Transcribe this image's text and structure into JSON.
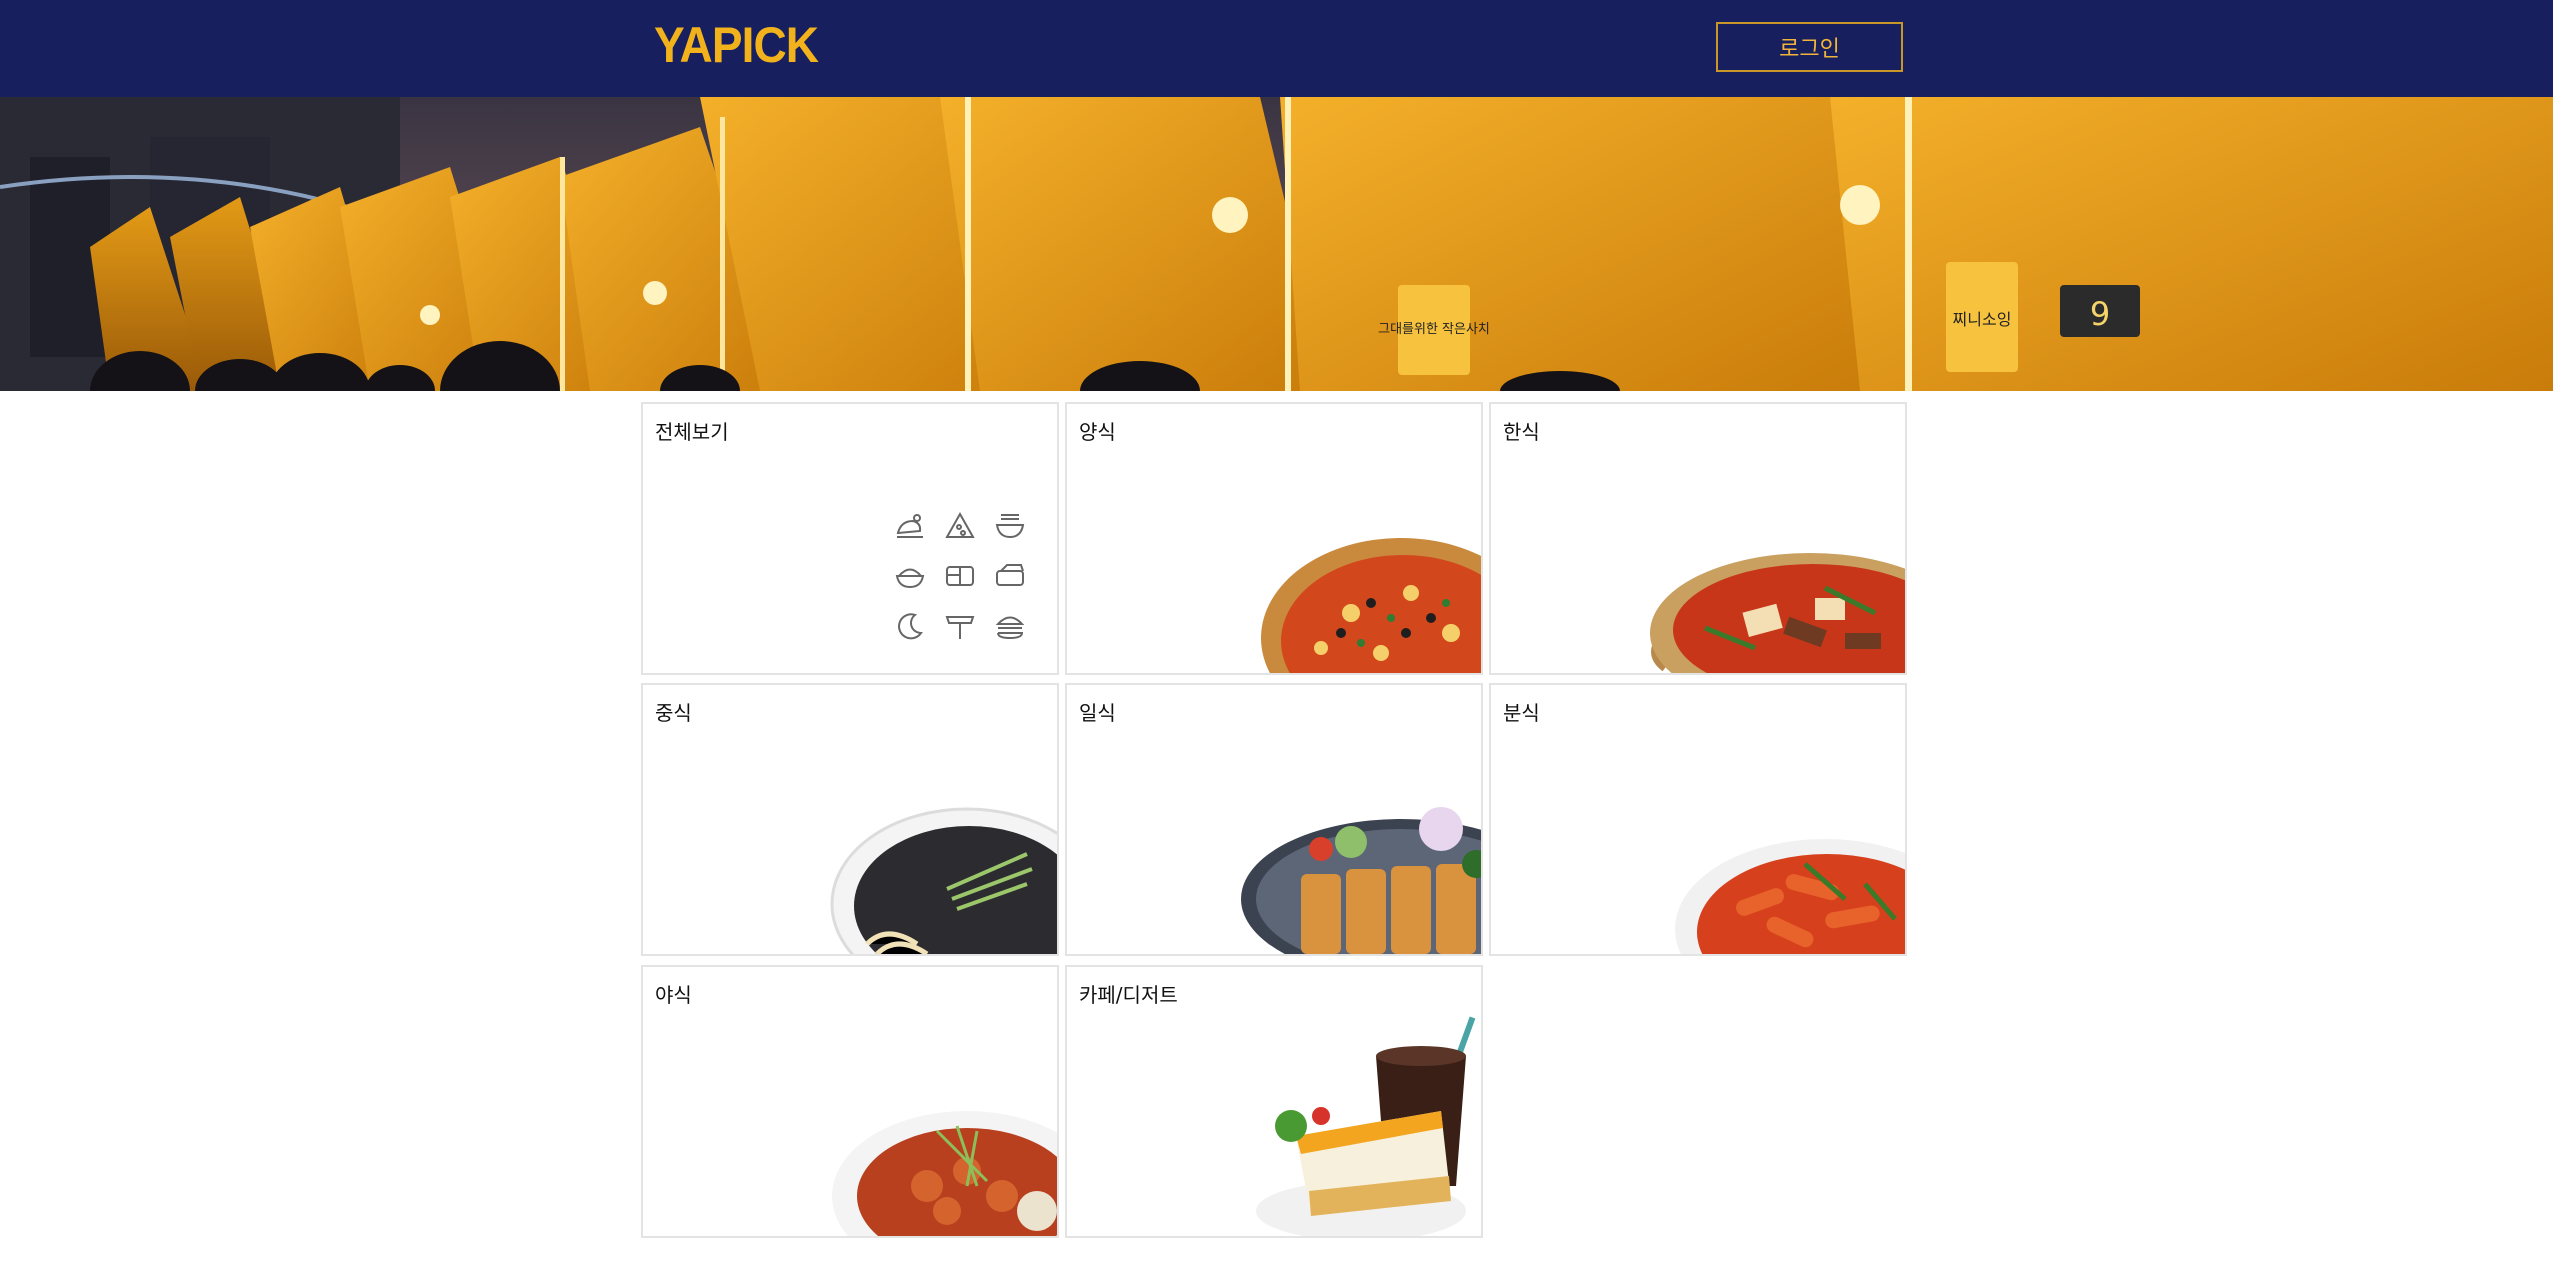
{
  "header": {
    "logo": "YAPICK",
    "login_label": "로그인"
  },
  "banner": {
    "sign1": "그대를위한 작은사치",
    "sign2": "찌니소잉",
    "sign3": "9"
  },
  "categories": [
    {
      "label": "전체보기",
      "image": "all-icons"
    },
    {
      "label": "양식",
      "image": "pizza"
    },
    {
      "label": "한식",
      "image": "stew"
    },
    {
      "label": "중식",
      "image": "jajangmyeon"
    },
    {
      "label": "일식",
      "image": "tonkatsu"
    },
    {
      "label": "분식",
      "image": "tteokbokki"
    },
    {
      "label": "야식",
      "image": "spicy-dish"
    },
    {
      "label": "카페/디저트",
      "image": "cake-and-coffee"
    }
  ],
  "colors": {
    "header_bg": "#171f5e",
    "brand_yellow": "#f2b21c",
    "card_border": "#e3e3e3"
  }
}
